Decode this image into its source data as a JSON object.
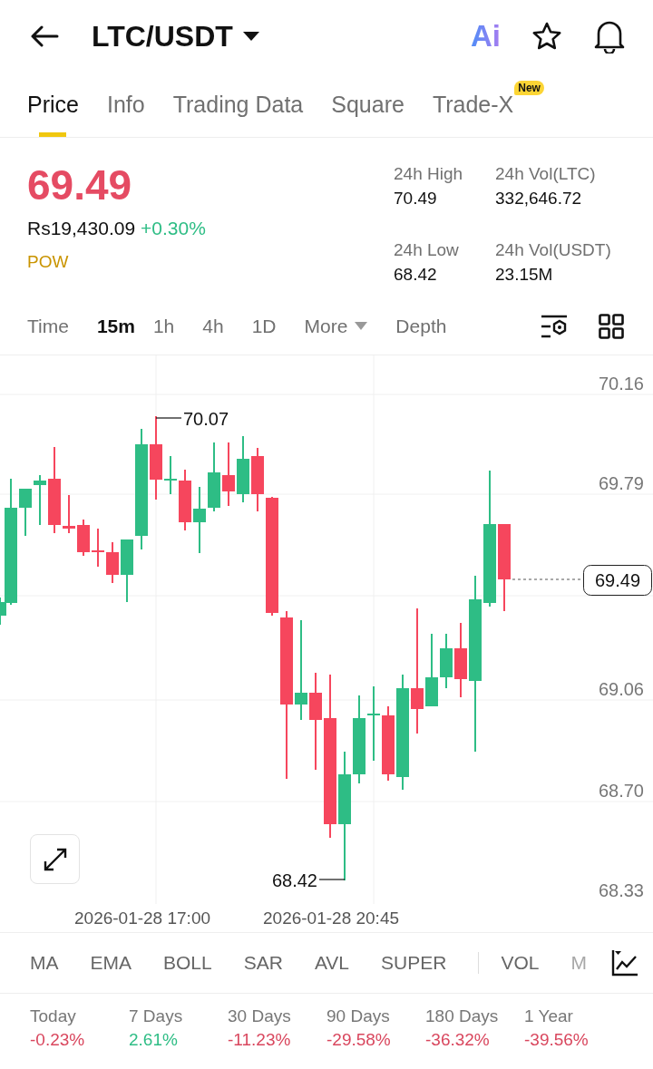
{
  "header": {
    "title": "LTC/USDT",
    "ai_label": "Ai"
  },
  "tabs": [
    {
      "label": "Price",
      "selected": true
    },
    {
      "label": "Info",
      "selected": false
    },
    {
      "label": "Trading Data",
      "selected": false
    },
    {
      "label": "Square",
      "selected": false
    },
    {
      "label": "Trade-X",
      "selected": false,
      "badge": "New"
    }
  ],
  "price": {
    "last": "69.49",
    "fiat": "Rs19,430.09",
    "change": "+0.30%",
    "tag": "POW"
  },
  "stats": [
    {
      "label": "24h High",
      "value": "70.49"
    },
    {
      "label": "24h Vol(LTC)",
      "value": "332,646.72"
    },
    {
      "label": "24h Low",
      "value": "68.42"
    },
    {
      "label": "24h Vol(USDT)",
      "value": "23.15M"
    }
  ],
  "intervals": [
    {
      "label": "Time",
      "kind": "option",
      "selected": false
    },
    {
      "label": "15m",
      "kind": "option",
      "selected": true
    },
    {
      "label": "1h",
      "kind": "option",
      "selected": false
    },
    {
      "label": "4h",
      "kind": "option",
      "selected": false
    },
    {
      "label": "1D",
      "kind": "option",
      "selected": false
    },
    {
      "label": "More",
      "kind": "dropdown",
      "selected": false
    },
    {
      "label": "Depth",
      "kind": "option",
      "selected": false
    }
  ],
  "chart": {
    "y_labels": [
      "70.16",
      "69.79",
      "69.06",
      "68.70",
      "68.33"
    ],
    "high_label": "70.07",
    "low_label": "68.42",
    "last_price": "69.49",
    "x_labels": [
      "2026-01-28 17:00",
      "2026-01-28 20:45"
    ]
  },
  "indicators": [
    "MA",
    "EMA",
    "BOLL",
    "SAR",
    "AVL",
    "SUPER",
    "VOL",
    "M"
  ],
  "performance": [
    {
      "period": "Today",
      "change": "-0.23%",
      "color": "#d9475e"
    },
    {
      "period": "7 Days",
      "change": "2.61%",
      "color": "#2ebd85"
    },
    {
      "period": "30 Days",
      "change": "-11.23%",
      "color": "#d9475e"
    },
    {
      "period": "90 Days",
      "change": "-29.58%",
      "color": "#d9475e"
    },
    {
      "period": "180 Days",
      "change": "-36.32%",
      "color": "#d9475e"
    },
    {
      "period": "1 Year",
      "change": "-39.56%",
      "color": "#d9475e"
    }
  ]
}
